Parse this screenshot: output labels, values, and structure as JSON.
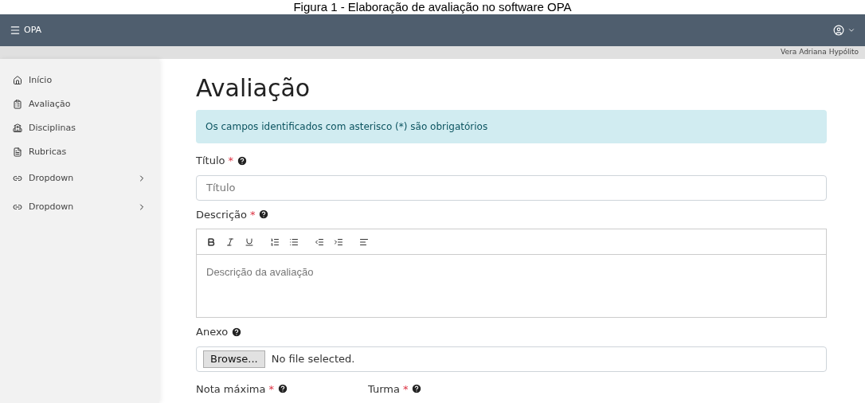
{
  "caption": "Figura 1 - Elaboração de avaliação no software OPA",
  "navbar": {
    "brand": "OPA",
    "user": "Vera Adriana Hypólito"
  },
  "sidebar": {
    "items": [
      {
        "label": "Início",
        "kind": "page"
      },
      {
        "label": "Avaliação",
        "kind": "page"
      },
      {
        "label": "Disciplinas",
        "kind": "page"
      },
      {
        "label": "Rubricas",
        "kind": "page"
      },
      {
        "label": "Dropdown",
        "kind": "dropdown"
      },
      {
        "label": "Dropdown",
        "kind": "dropdown"
      }
    ]
  },
  "page": {
    "title": "Avaliação",
    "alert": "Os campos identificados com asterisco (*) são obrigatórios",
    "fields": [
      {
        "kind": "text",
        "label": "Título",
        "required": "*",
        "placeholder": "Título"
      },
      {
        "kind": "editor",
        "label": "Descrição",
        "required": "*",
        "placeholder": "Descrição da avaliação"
      },
      {
        "kind": "file",
        "label": "Anexo",
        "button": "Browse...",
        "value": "No file selected."
      }
    ],
    "bottom_labels": [
      {
        "label": "Nota máxima",
        "required": "*"
      },
      {
        "label": "Turma",
        "required": "*"
      }
    ]
  }
}
